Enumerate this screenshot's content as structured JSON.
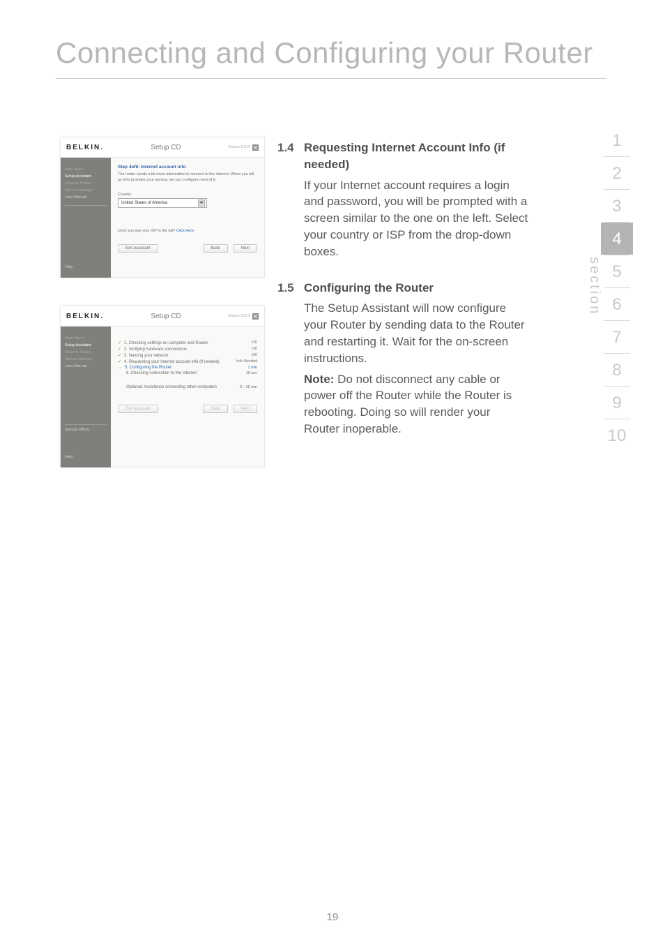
{
  "page": {
    "title": "Connecting and Configuring your Router",
    "number": "19"
  },
  "section_nav": {
    "label": "section",
    "items": [
      "1",
      "2",
      "3",
      "4",
      "5",
      "6",
      "7",
      "8",
      "9",
      "10"
    ],
    "active_index": 3
  },
  "content": {
    "s14": {
      "num": "1.4",
      "heading": "Requesting Internet Account Info (if needed)",
      "body": "If your Internet account requires a login and password, you will be prompted with a screen similar to the one on the left. Select your country or ISP from the drop-down boxes."
    },
    "s15": {
      "num": "1.5",
      "heading": "Configuring the Router",
      "body": "The Setup Assistant will now configure your Router by sending data to the Router and restarting it. Wait for the on-screen instructions.",
      "note_label": "Note:",
      "note_body": " Do not disconnect any cable or power off the Router while the Router is rebooting. Doing so will render your Router inoperable."
    }
  },
  "mock1": {
    "brand": "BELKIN.",
    "title": "Setup CD",
    "version": "Version 1.00.0",
    "nav": [
      "Main Menu",
      "Setup Assistant",
      "Network Status",
      "Manual Settings",
      "User Manual"
    ],
    "footer_nav": "Help",
    "step_title": "Step 4of6: Internet account info",
    "step_desc": "The router needs a bit more information to connect to the Internet. When you tell us who provides your service, we can configure most of it.",
    "country_label": "Country",
    "country_value": "United States of America",
    "isp_line_a": "Don't you see your ISP in the list? ",
    "isp_line_b": "Click Here",
    "btn_exit": "Exit Assistant",
    "btn_back": "Back",
    "btn_next": "Next"
  },
  "mock2": {
    "brand": "BELKIN.",
    "title": "Setup CD",
    "version": "Version 1.00.0",
    "nav": [
      "Main Menu",
      "Setup Assistant",
      "Network Status",
      "Manual Settings",
      "User Manual"
    ],
    "footer_nav1": "Special Offers",
    "footer_nav2": "Help",
    "rows": [
      {
        "icon": "check",
        "label": "1. Checking settings on computer and Router",
        "status": "OK"
      },
      {
        "icon": "check",
        "label": "2. Verifying hardware connections",
        "status": "OK"
      },
      {
        "icon": "check",
        "label": "3. Naming your network",
        "status": "OK"
      },
      {
        "icon": "check",
        "label": "4. Requesting your Internet account info (if needed)",
        "status": "Info Needed"
      },
      {
        "icon": "arrow",
        "label": "5. Configuring the Router",
        "status": "1 min",
        "blue": true
      },
      {
        "icon": "",
        "label": "6. Checking connection to the Internet",
        "status": "10 sec"
      }
    ],
    "optional": {
      "label": "Optional: Assistance connecting other computers",
      "status": "5 - 15 min"
    },
    "btn_exit": "Exit Assistant",
    "btn_back": "Back",
    "btn_next": "Next"
  }
}
